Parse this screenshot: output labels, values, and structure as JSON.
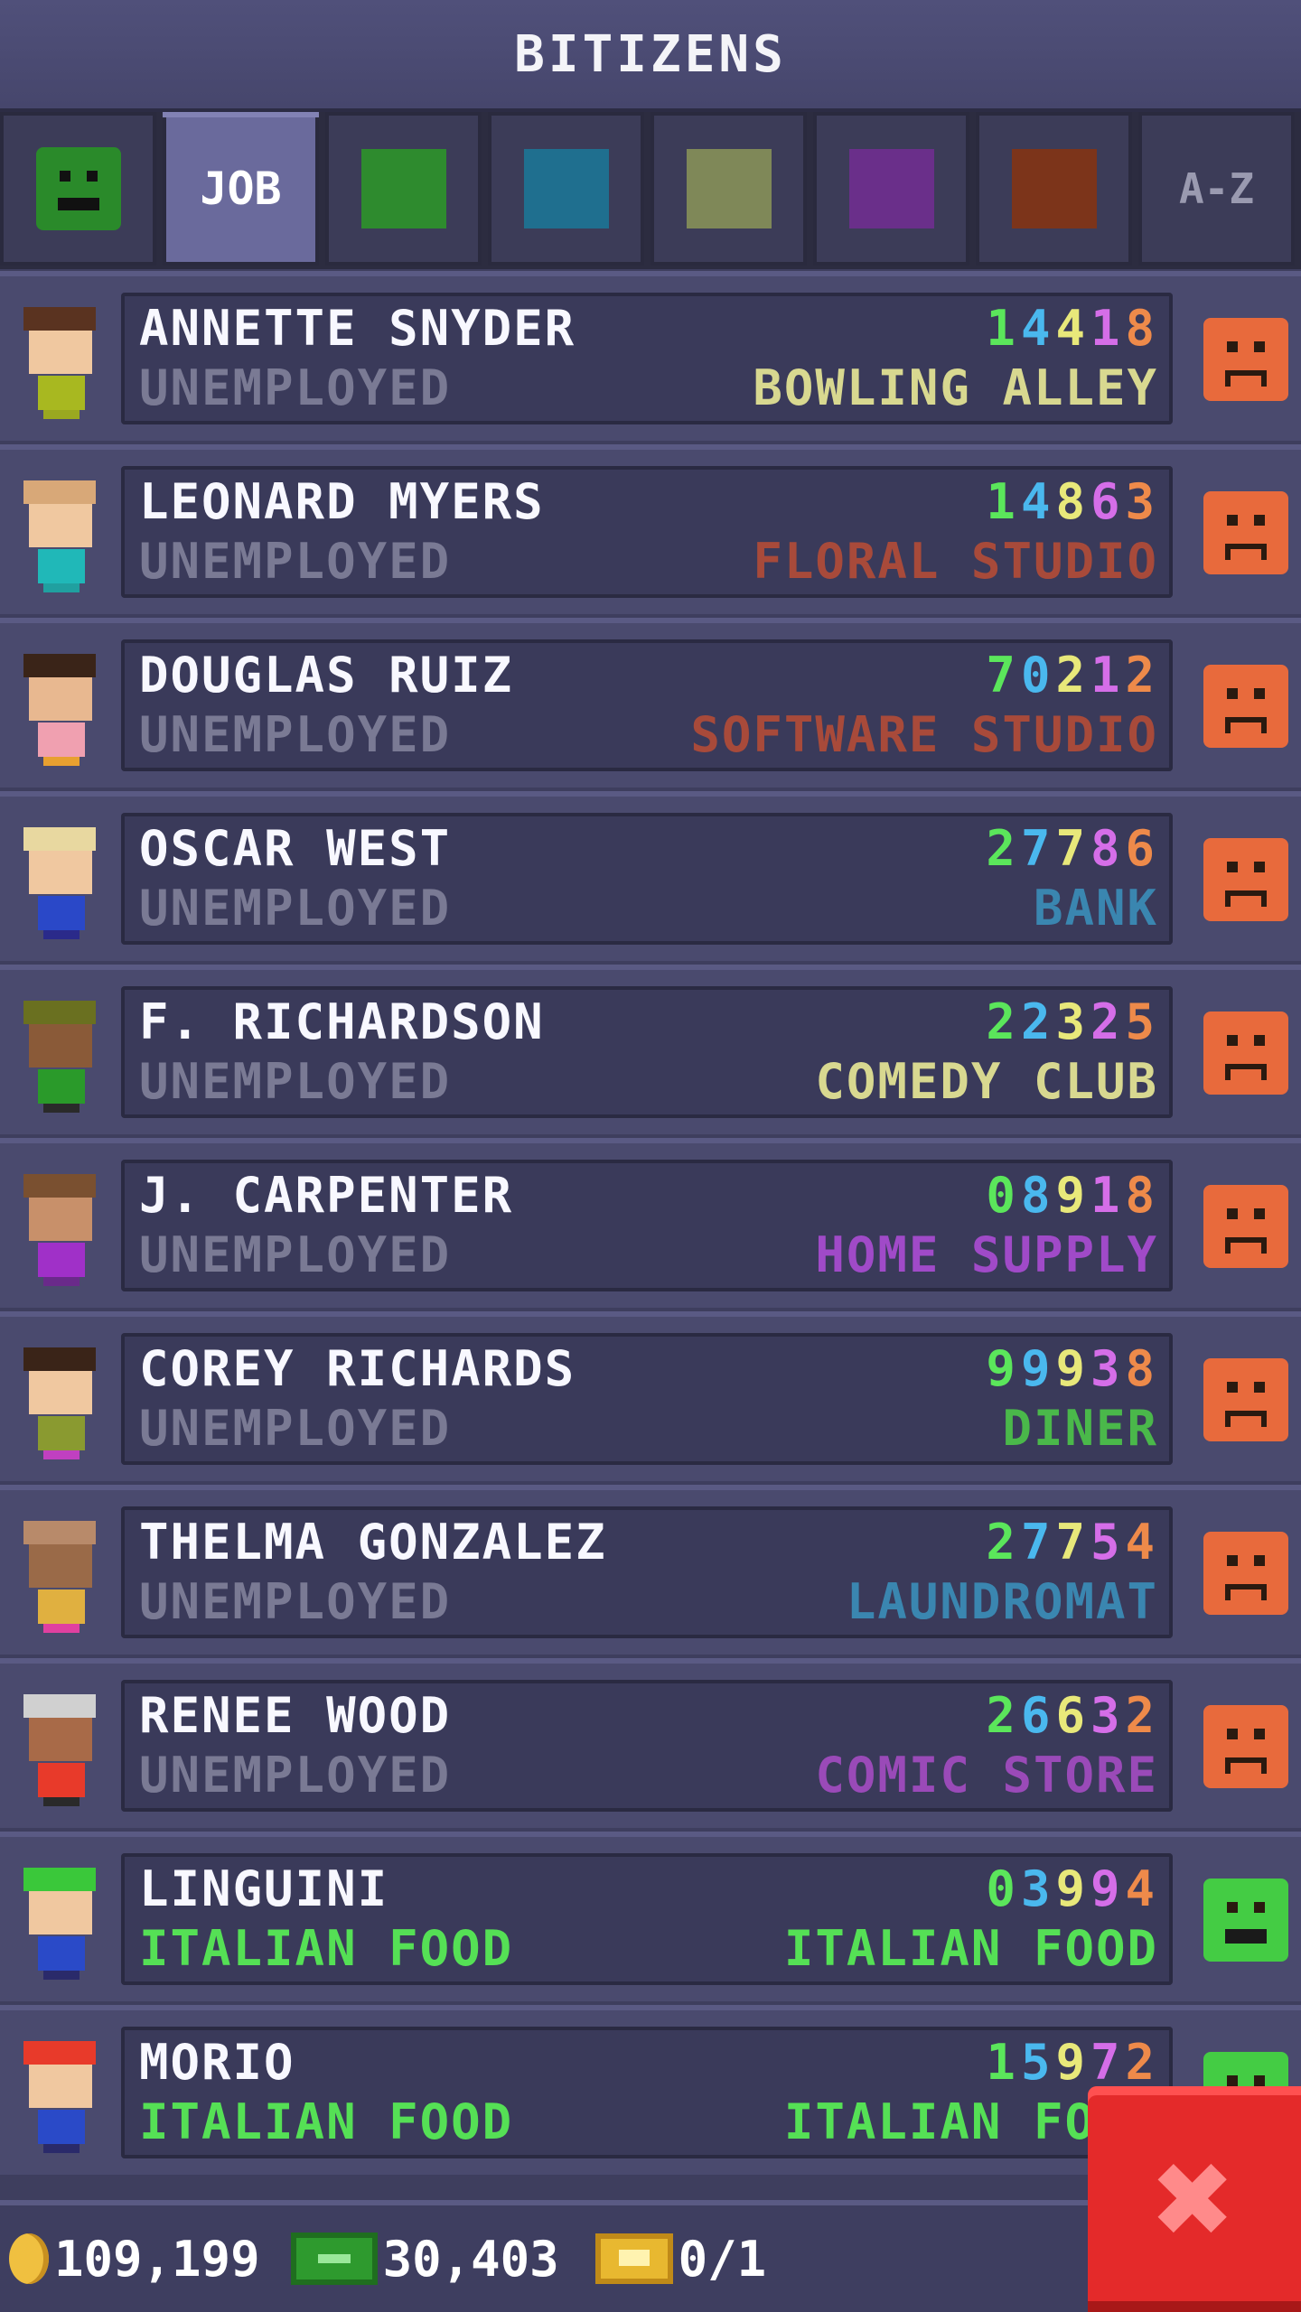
{
  "app": {
    "title": "BITIZENS"
  },
  "tabs": [
    {
      "type": "icon",
      "icon": "happy-face-icon"
    },
    {
      "type": "label",
      "label": "JOB",
      "active": true
    },
    {
      "type": "color",
      "color": "#2e8b2e"
    },
    {
      "type": "color",
      "color": "#1f6f8f"
    },
    {
      "type": "color",
      "color": "#7f8858"
    },
    {
      "type": "color",
      "color": "#6a2f8a"
    },
    {
      "type": "color",
      "color": "#7c341a"
    },
    {
      "type": "label",
      "label": "A-Z"
    }
  ],
  "residents": [
    {
      "name": "ANNETTE SNYDER",
      "job": "UNEMPLOYED",
      "digits": [
        "1",
        "4",
        "4",
        "1",
        "8"
      ],
      "dream_job": "BOWLING ALLEY",
      "dream_color": "#d8d890",
      "mood": "sad",
      "hair": "#5a3320",
      "skin": "#f0c8a0",
      "shirt": "#a8b820",
      "legs": "#9aa820"
    },
    {
      "name": "LEONARD MYERS",
      "job": "UNEMPLOYED",
      "digits": [
        "1",
        "4",
        "8",
        "6",
        "3"
      ],
      "dream_job": "FLORAL STUDIO",
      "dream_color": "#a84a3a",
      "mood": "sad",
      "hair": "#d8a878",
      "skin": "#f0c8a0",
      "shirt": "#20b8b8",
      "legs": "#20a0a0"
    },
    {
      "name": "DOUGLAS RUIZ",
      "job": "UNEMPLOYED",
      "digits": [
        "7",
        "0",
        "2",
        "1",
        "2"
      ],
      "dream_job": "SOFTWARE STUDIO",
      "dream_color": "#a84a3a",
      "mood": "sad",
      "hair": "#3a2418",
      "skin": "#e8b890",
      "shirt": "#f0a0b0",
      "legs": "#e8a030"
    },
    {
      "name": "OSCAR WEST",
      "job": "UNEMPLOYED",
      "digits": [
        "2",
        "7",
        "7",
        "8",
        "6"
      ],
      "dream_job": "BANK",
      "dream_color": "#3a86b0",
      "mood": "sad",
      "hair": "#e8d8a0",
      "skin": "#f0c8a0",
      "shirt": "#2a48c8",
      "legs": "#2a2a8a"
    },
    {
      "name": "F. RICHARDSON",
      "job": "UNEMPLOYED",
      "digits": [
        "2",
        "2",
        "3",
        "2",
        "5"
      ],
      "dream_job": "COMEDY CLUB",
      "dream_color": "#d8d890",
      "mood": "sad",
      "hair": "#6a7020",
      "skin": "#8a5a38",
      "shirt": "#2a9a2a",
      "legs": "#2a2a2a"
    },
    {
      "name": "J. CARPENTER",
      "job": "UNEMPLOYED",
      "digits": [
        "0",
        "8",
        "9",
        "1",
        "8"
      ],
      "dream_job": "HOME SUPPLY",
      "dream_color": "#a04ac8",
      "mood": "sad",
      "hair": "#7a5030",
      "skin": "#c8906a",
      "shirt": "#a030c8",
      "legs": "#6a2a8a"
    },
    {
      "name": "COREY RICHARDS",
      "job": "UNEMPLOYED",
      "digits": [
        "9",
        "9",
        "9",
        "3",
        "8"
      ],
      "dream_job": "DINER",
      "dream_color": "#4ab84a",
      "mood": "sad",
      "hair": "#3a2418",
      "skin": "#f0c8a0",
      "shirt": "#8a9a30",
      "legs": "#c040c0"
    },
    {
      "name": "THELMA GONZALEZ",
      "job": "UNEMPLOYED",
      "digits": [
        "2",
        "7",
        "7",
        "5",
        "4"
      ],
      "dream_job": "LAUNDROMAT",
      "dream_color": "#3a86b0",
      "mood": "sad",
      "hair": "#b88a6a",
      "skin": "#9a6a48",
      "shirt": "#e0b040",
      "legs": "#e040a0"
    },
    {
      "name": "RENEE WOOD",
      "job": "UNEMPLOYED",
      "digits": [
        "2",
        "6",
        "6",
        "3",
        "2"
      ],
      "dream_job": "COMIC STORE",
      "dream_color": "#9a4ab8",
      "mood": "sad",
      "hair": "#d0d0d0",
      "skin": "#a86a48",
      "shirt": "#e83a2a",
      "legs": "#2a2a2a"
    },
    {
      "name": "LINGUINI",
      "job": "ITALIAN FOOD",
      "job_employed": true,
      "digits": [
        "0",
        "3",
        "9",
        "9",
        "4"
      ],
      "dream_job": "ITALIAN FOOD",
      "dream_color": "#55e055",
      "mood": "happy",
      "hair": "#3ac83a",
      "skin": "#f0c8a0",
      "shirt": "#2a4ac8",
      "legs": "#2a2a6a"
    },
    {
      "name": "MORIO",
      "job": "ITALIAN FOOD",
      "job_employed": true,
      "digits": [
        "1",
        "5",
        "9",
        "7",
        "2"
      ],
      "dream_job": "ITALIAN FOOD",
      "dream_color": "#55e055",
      "mood": "happy",
      "hair": "#e83a2a",
      "skin": "#f0c8a0",
      "shirt": "#2a4ac8",
      "legs": "#2a2a6a"
    }
  ],
  "footer": {
    "coins": "109,199",
    "coin_icon": "coin-icon",
    "bux": "30,403",
    "bux_icon": "bux-icon",
    "tickets": "0/1",
    "ticket_icon": "ticket-icon"
  },
  "close_button": {
    "label": "✖",
    "icon": "close-icon",
    "color": "#e42a2a"
  }
}
